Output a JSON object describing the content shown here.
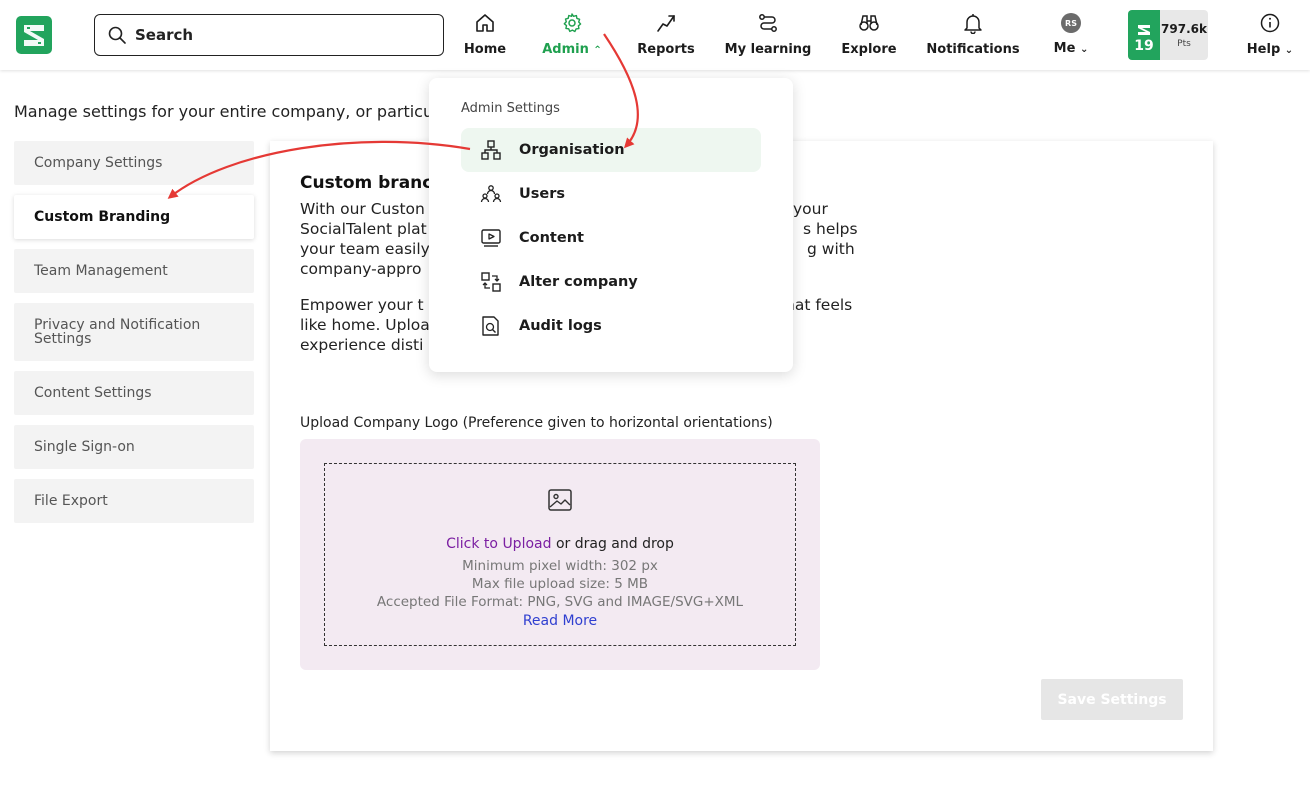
{
  "search": {
    "placeholder": "Search"
  },
  "nav": {
    "items": [
      {
        "label": "Home",
        "icon": "home-icon"
      },
      {
        "label": "Admin",
        "icon": "gear-icon",
        "active": true
      },
      {
        "label": "Reports",
        "icon": "trend-icon"
      },
      {
        "label": "My learning",
        "icon": "path-icon"
      },
      {
        "label": "Explore",
        "icon": "binoculars-icon"
      },
      {
        "label": "Notifications",
        "icon": "bell-icon"
      },
      {
        "label": "Me",
        "icon": "avatar"
      },
      {
        "label": "Help",
        "icon": "info-icon"
      }
    ],
    "avatar_initials": "RS",
    "level": "19",
    "points_value": "797.6k",
    "points_unit": "Pts"
  },
  "intro": "Manage settings for your entire company, or particu",
  "sidebar": {
    "items": [
      {
        "label": "Company Settings"
      },
      {
        "label": "Custom Branding",
        "active": true
      },
      {
        "label": "Team Management"
      },
      {
        "label": "Privacy and Notification Settings"
      },
      {
        "label": "Content Settings"
      },
      {
        "label": "Single Sign-on"
      },
      {
        "label": "File Export"
      }
    ]
  },
  "main": {
    "title": "Custom branc",
    "para1_lines": [
      "With our Custon",
      "SocialTalent plat",
      "your team easily",
      "company-appro"
    ],
    "para1_right_lines": [
      "your",
      "s helps",
      "g with"
    ],
    "para2_lines": [
      "Empower your t",
      "like home. Uploa",
      "experience disti"
    ],
    "para2_right_lines": [
      "nat feels"
    ],
    "upload_label": "Upload Company Logo (Preference given to horizontal orientations)",
    "upload_link": "Click to Upload",
    "upload_text": " or drag and drop",
    "min_width": "Minimum pixel width: 302 px",
    "max_size": "Max file upload size: 5 MB",
    "formats": "Accepted File Format: PNG, SVG and IMAGE/SVG+XML",
    "read_more": "Read More",
    "save_label": "Save Settings"
  },
  "dropdown": {
    "header": "Admin Settings",
    "items": [
      {
        "label": "Organisation",
        "icon": "hierarchy-icon",
        "highlighted": true
      },
      {
        "label": "Users",
        "icon": "users-icon"
      },
      {
        "label": "Content",
        "icon": "video-icon"
      },
      {
        "label": "Alter company",
        "icon": "swap-icon"
      },
      {
        "label": "Audit logs",
        "icon": "document-search-icon"
      }
    ]
  },
  "colors": {
    "brand_green": "#22a45d",
    "active_nav": "#1fa04f",
    "link_purple": "#7b1fa2",
    "link_blue": "#2f3fd0",
    "arrow_red": "#e53935",
    "upload_bg": "#f3eaf2"
  }
}
